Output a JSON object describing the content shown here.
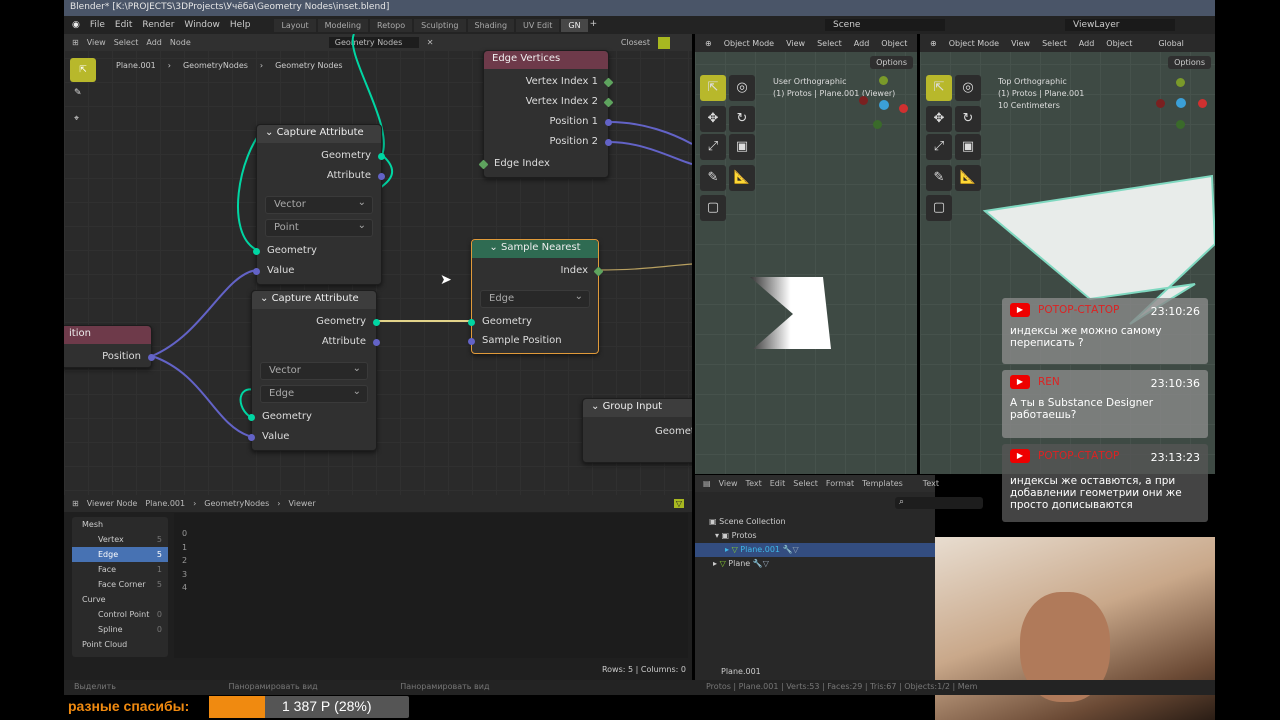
{
  "window_title": "Blender* [K:\\PROJECTS\\3DProjects\\Учёба\\Geometry Nodes\\inset.blend]",
  "menu": [
    "File",
    "Edit",
    "Render",
    "Window",
    "Help"
  ],
  "workspaces": [
    {
      "label": "Layout"
    },
    {
      "label": "Modeling"
    },
    {
      "label": "Retopo"
    },
    {
      "label": "Sculpting"
    },
    {
      "label": "Shading"
    },
    {
      "label": "UV Edit"
    },
    {
      "label": "GN",
      "active": true
    }
  ],
  "scene": "Scene",
  "view_layer": "ViewLayer",
  "node_editor": {
    "menu": [
      "View",
      "Select",
      "Add",
      "Node"
    ],
    "node_tree": "Geometry Nodes",
    "snap": "Closest",
    "breadcrumb": [
      "Plane.001",
      "GeometryNodes",
      "Geometry Nodes"
    ],
    "nodes": {
      "edge_vertices": {
        "title": "Edge Vertices",
        "outputs": [
          "Vertex Index 1",
          "Vertex Index 2",
          "Position 1",
          "Position 2"
        ],
        "input": "Edge Index"
      },
      "capture1": {
        "title": "Capture Attribute",
        "outputs": [
          "Geometry",
          "Attribute"
        ],
        "type": "Vector",
        "domain": "Point",
        "inputs": [
          "Geometry",
          "Value"
        ]
      },
      "capture2": {
        "title": "Capture Attribute",
        "outputs": [
          "Geometry",
          "Attribute"
        ],
        "type": "Vector",
        "domain": "Edge",
        "inputs": [
          "Geometry",
          "Value"
        ]
      },
      "sample_nearest": {
        "title": "Sample Nearest",
        "output": "Index",
        "domain": "Edge",
        "inputs": [
          "Geometry",
          "Sample Position"
        ]
      },
      "position": {
        "title": "ition",
        "output": "Position"
      },
      "group_input": {
        "title": "Group Input",
        "output": "Geometr"
      }
    }
  },
  "viewport_left": {
    "mode": "Object Mode",
    "menu": [
      "View",
      "Select",
      "Add",
      "Object"
    ],
    "options": "Options",
    "info": [
      "User Orthographic",
      "(1) Protos | Plane.001 (Viewer)"
    ]
  },
  "viewport_right": {
    "mode": "Object Mode",
    "menu": [
      "View",
      "Select",
      "Add",
      "Object"
    ],
    "orientation": "Global",
    "options": "Options",
    "info": [
      "Top Orthographic",
      "(1) Protos | Plane.001",
      "10 Centimeters"
    ]
  },
  "chat": [
    {
      "name": "РОТОР-СТАТОР",
      "time": "23:10:26",
      "text": "индексы же можно самому переписать ?"
    },
    {
      "name": "REN",
      "time": "23:10:36",
      "text": "А ты в Substance Designer работаешь?"
    },
    {
      "name": "РОТОР-СТАТОР",
      "time": "23:13:23",
      "text": "индексы же оставются, а при добавлении геометрии они же просто дописываются"
    }
  ],
  "text_editor": {
    "menu": [
      "View",
      "Text",
      "Edit",
      "Select",
      "Format",
      "Templates"
    ],
    "text": "Text"
  },
  "outliner": {
    "items": [
      "Scene Collection",
      "Protos",
      "Plane.001",
      "Plane"
    ],
    "footer": "Plane.001"
  },
  "spreadsheet": {
    "header": [
      "Viewer Node",
      "Plane.001",
      "GeometryNodes",
      "Viewer"
    ],
    "domains": [
      {
        "label": "Mesh"
      },
      {
        "label": "Vertex",
        "count": "5"
      },
      {
        "label": "Edge",
        "count": "5",
        "selected": true
      },
      {
        "label": "Face",
        "count": "1"
      },
      {
        "label": "Face Corner",
        "count": "5"
      },
      {
        "label": "Curve"
      },
      {
        "label": "Control Point",
        "count": "0"
      },
      {
        "label": "Spline",
        "count": "0"
      },
      {
        "label": "Point Cloud"
      }
    ],
    "rows": [
      "0",
      "1",
      "2",
      "3",
      "4"
    ],
    "rows_label": "Rows: 5",
    "cols_label": "Columns: 0"
  },
  "statusbar": {
    "hints": [
      "Выделить",
      "Панорамировать вид",
      "Панорамировать вид"
    ],
    "stats": "Protos | Plane.001 | Verts:53 | Faces:29 | Tris:67 | Objects:1/2 | Mem"
  },
  "donation": {
    "label": "разные спасибы:",
    "amount": "1 387 Р (28%)",
    "progress": 0.28,
    "color": "#f08a10"
  }
}
